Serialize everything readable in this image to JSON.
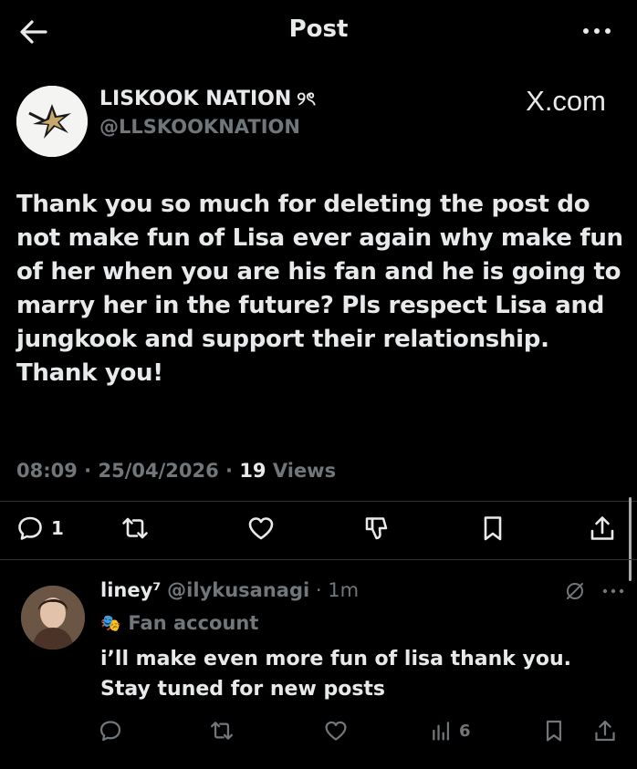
{
  "header": {
    "title": "Post"
  },
  "post": {
    "author_name": "LISKOOK NATION",
    "author_name_emoji": "୨ৎ",
    "handle": "@LLSKOOKNATION",
    "source_watermark": "X.com",
    "text": "Thank you so much for deleting the post do not make fun of Lisa ever again why make fun of her when you are his fan and he is going to marry her in the future? Pls respect Lisa and jungkook and support their relationship. Thank you!",
    "time": "08:09",
    "date": "25/04/2026",
    "views_count": "19",
    "views_label": "Views",
    "reply_count": "1"
  },
  "reply": {
    "name": "liney⁷",
    "handle": "@ilykusanagi",
    "time": "1m",
    "label_emoji": "🎭",
    "label": "Fan account",
    "text": "i’ll make even more fun of lisa thank you. Stay tuned for new posts",
    "views_count": "6"
  },
  "colors": {
    "background": "#000000",
    "text_primary": "#e7e9ea",
    "text_secondary": "#71767b",
    "divider": "#2f3336"
  },
  "icons": {
    "back": "arrow-left-icon",
    "more": "more-dots-icon",
    "reply": "reply-bubble-icon",
    "repost": "repost-icon",
    "like": "heart-icon",
    "downvote": "downvote-icon",
    "bookmark": "bookmark-icon",
    "share": "share-icon",
    "views": "views-bars-icon",
    "grok": "grok-icon"
  }
}
